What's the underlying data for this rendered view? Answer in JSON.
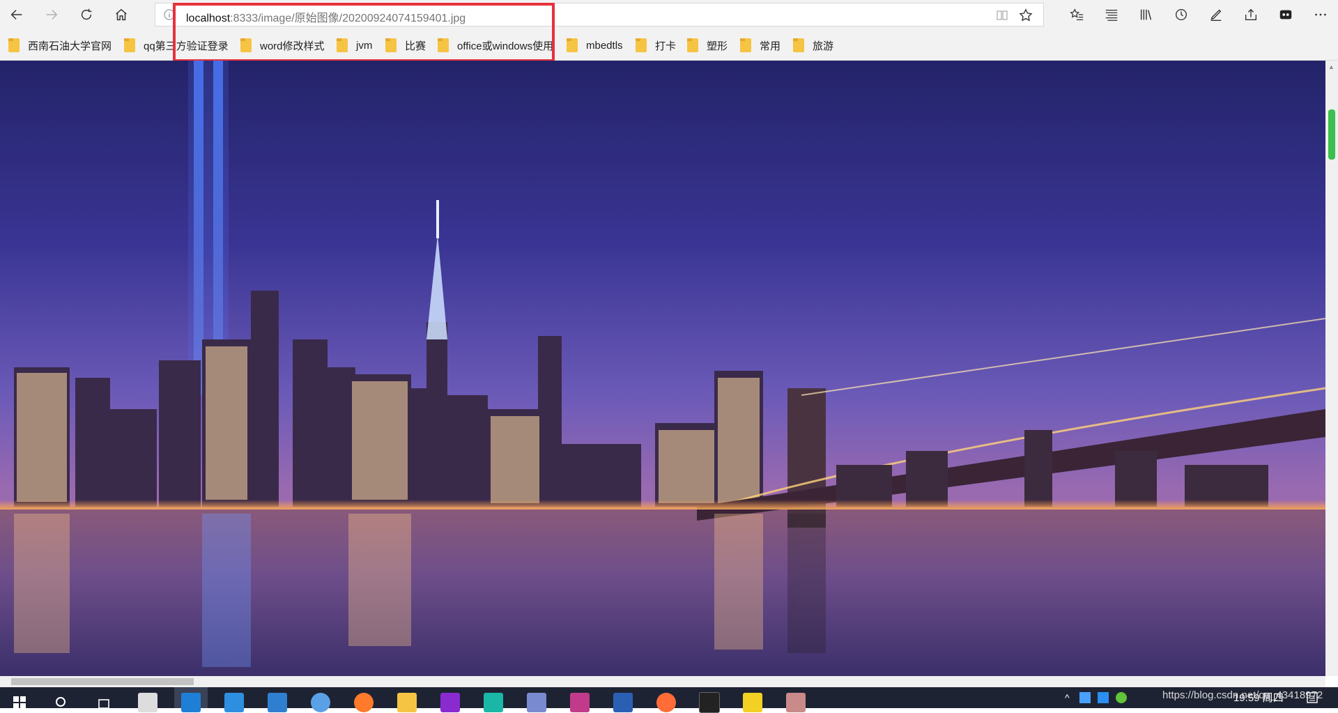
{
  "browser": {
    "address": {
      "host": "localhost",
      "path": ":8333/image/原始图像/20200924074159401.jpg"
    },
    "favorites": [
      {
        "label": "西南石油大学官网"
      },
      {
        "label": "qq第三方验证登录"
      },
      {
        "label": "word修改样式"
      },
      {
        "label": "jvm"
      },
      {
        "label": "比赛"
      },
      {
        "label": "office或windows使用"
      },
      {
        "label": "mbedtls"
      },
      {
        "label": "打卡"
      },
      {
        "label": "塑形"
      },
      {
        "label": "常用"
      },
      {
        "label": "旅游"
      }
    ],
    "highlight_color": "#e6323c"
  },
  "page": {
    "image_subject": "night city skyline with bridge"
  },
  "taskbar": {
    "clock": "19:59 周四",
    "watermark": "https://blog.csdn.net/qq_43418972"
  }
}
